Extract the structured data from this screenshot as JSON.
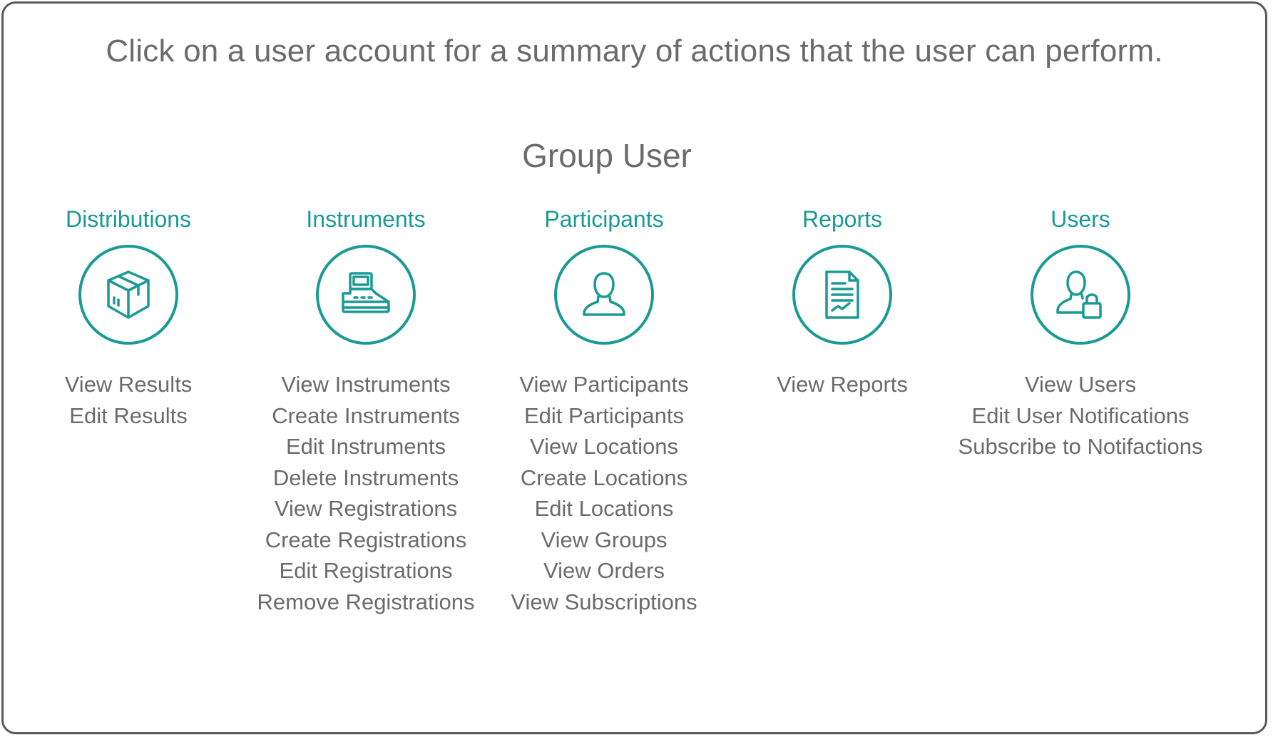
{
  "instruction": "Click on a user account for a summary of actions that the user can perform.",
  "role_title": "Group User",
  "colors": {
    "accent": "#1a9a94",
    "text": "#6b6b6b",
    "border": "#5a5a5a"
  },
  "columns": [
    {
      "heading": "Distributions",
      "icon": "box-icon",
      "actions": [
        "View Results",
        "Edit Results"
      ]
    },
    {
      "heading": "Instruments",
      "icon": "instrument-machine-icon",
      "actions": [
        "View Instruments",
        "Create Instruments",
        "Edit Instruments",
        "Delete Instruments",
        "View Registrations",
        "Create Registrations",
        "Edit Registrations",
        "Remove Registrations"
      ]
    },
    {
      "heading": "Participants",
      "icon": "person-icon",
      "actions": [
        "View Participants",
        "Edit Participants",
        "View Locations",
        "Create Locations",
        "Edit Locations",
        "View Groups",
        "View Orders",
        "View Subscriptions"
      ]
    },
    {
      "heading": "Reports",
      "icon": "report-document-icon",
      "actions": [
        "View Reports"
      ]
    },
    {
      "heading": "Users",
      "icon": "user-lock-icon",
      "actions": [
        "View Users",
        "Edit User Notifications",
        "Subscribe to Notifactions"
      ]
    }
  ]
}
